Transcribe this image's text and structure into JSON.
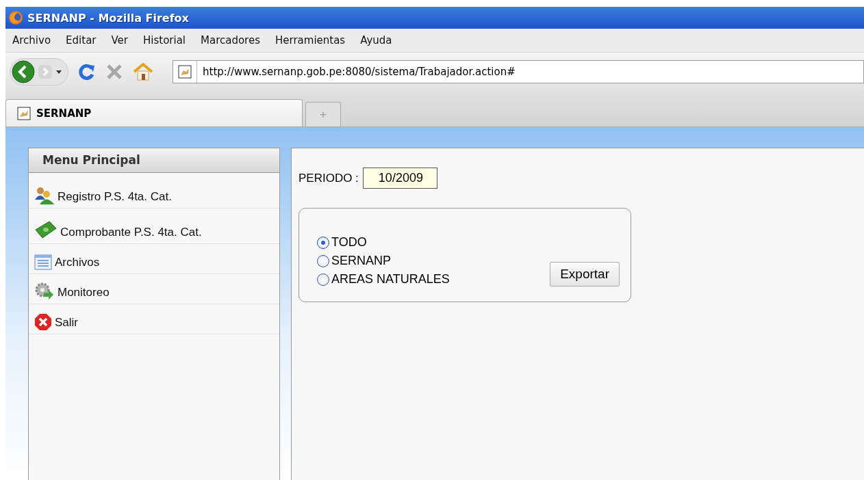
{
  "window": {
    "title": "SERNANP - Mozilla Firefox"
  },
  "menu_bar": [
    "Archivo",
    "Editar",
    "Ver",
    "Historial",
    "Marcadores",
    "Herramientas",
    "Ayuda"
  ],
  "address_bar": {
    "value": "http://www.sernanp.gob.pe:8080/sistema/Trabajador.action#"
  },
  "tabs": [
    {
      "label": "SERNANP",
      "selected": true
    }
  ],
  "new_tab": "+",
  "sidebar": {
    "title": "Menu Principal",
    "items": [
      {
        "label": "Registro P.S. 4ta. Cat.",
        "kind": "users"
      },
      {
        "label": "Comprobante P.S. 4ta. Cat.",
        "kind": "money"
      },
      {
        "label": "Archivos",
        "kind": "list"
      },
      {
        "label": "Monitoreo",
        "kind": "gear"
      },
      {
        "label": "Salir",
        "kind": "exit"
      }
    ]
  },
  "form": {
    "period_label": "PERIODO :",
    "period_value": "10/2009",
    "options": [
      {
        "label": "TODO",
        "selected": true
      },
      {
        "label": "SERNANP",
        "selected": false
      },
      {
        "label": "AREAS NATURALES",
        "selected": false
      }
    ],
    "export_button": "Exportar"
  }
}
